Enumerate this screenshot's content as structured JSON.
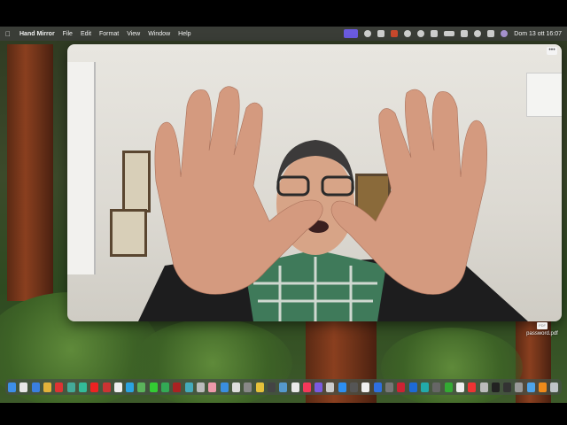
{
  "menubar": {
    "app_name": "Hand Mirror",
    "menus": [
      "File",
      "Edit",
      "Format",
      "View",
      "Window",
      "Help"
    ],
    "status_icons": [
      "screen-share-icon",
      "record-icon",
      "upload-icon",
      "fire-icon",
      "eye-icon",
      "play-icon",
      "screen-icon",
      "battery-icon",
      "wifi-icon",
      "search-icon",
      "control-center-icon",
      "siri-icon"
    ],
    "clock": "Dom 13 ott  16:07"
  },
  "window": {
    "menu_glyph": "•••"
  },
  "desktop": {
    "file_label": "password.pdf",
    "file_badge": "PDF"
  },
  "dock": {
    "icons": [
      {
        "name": "finder-icon",
        "color": "#3d8ee8"
      },
      {
        "name": "launchpad-icon",
        "color": "#e8e8e8"
      },
      {
        "name": "safari-icon",
        "color": "#3a7fe0"
      },
      {
        "name": "chrome-icon",
        "color": "#e2b23a"
      },
      {
        "name": "app-icon-1",
        "color": "#d33"
      },
      {
        "name": "app-icon-2",
        "color": "#4a9"
      },
      {
        "name": "app-icon-3",
        "color": "#3b9"
      },
      {
        "name": "youtube-icon",
        "color": "#e22"
      },
      {
        "name": "app-icon-4",
        "color": "#c33"
      },
      {
        "name": "gmail-icon",
        "color": "#eee"
      },
      {
        "name": "telegram-icon",
        "color": "#2aa3e0"
      },
      {
        "name": "maps-icon",
        "color": "#5bb35b"
      },
      {
        "name": "messages-icon",
        "color": "#3c3"
      },
      {
        "name": "app-icon-5",
        "color": "#3a5"
      },
      {
        "name": "app-icon-6",
        "color": "#a22"
      },
      {
        "name": "app-icon-7",
        "color": "#4ab"
      },
      {
        "name": "app-icon-8",
        "color": "#bbb"
      },
      {
        "name": "photos-icon",
        "color": "#e9a"
      },
      {
        "name": "app-icon-9",
        "color": "#3a8ee0"
      },
      {
        "name": "app-icon-10",
        "color": "#ddd"
      },
      {
        "name": "app-icon-11",
        "color": "#888"
      },
      {
        "name": "app-icon-12",
        "color": "#e5c13a"
      },
      {
        "name": "app-icon-13",
        "color": "#444"
      },
      {
        "name": "app-icon-14",
        "color": "#59c"
      },
      {
        "name": "app-icon-15",
        "color": "#e9e9e9"
      },
      {
        "name": "music-icon",
        "color": "#f3385a"
      },
      {
        "name": "app-icon-16",
        "color": "#7a5ae0"
      },
      {
        "name": "app-icon-17",
        "color": "#ccc"
      },
      {
        "name": "app-store-icon",
        "color": "#2d8ff0"
      },
      {
        "name": "app-icon-18",
        "color": "#555"
      },
      {
        "name": "app-icon-19",
        "color": "#f0f0f0"
      },
      {
        "name": "dropbox-icon",
        "color": "#2f6fe0"
      },
      {
        "name": "app-icon-20",
        "color": "#777"
      },
      {
        "name": "app-icon-21",
        "color": "#c23"
      },
      {
        "name": "app-icon-22",
        "color": "#1d6ad6"
      },
      {
        "name": "app-icon-23",
        "color": "#2aa"
      },
      {
        "name": "app-icon-24",
        "color": "#666"
      },
      {
        "name": "app-icon-25",
        "color": "#3a3"
      },
      {
        "name": "app-icon-26",
        "color": "#eee"
      },
      {
        "name": "app-icon-27",
        "color": "#e33"
      },
      {
        "name": "app-icon-28",
        "color": "#bbb"
      },
      {
        "name": "app-icon-29",
        "color": "#222"
      },
      {
        "name": "app-icon-30",
        "color": "#333"
      },
      {
        "name": "app-icon-31",
        "color": "#999"
      },
      {
        "name": "folder-icon",
        "color": "#4ea3e8"
      },
      {
        "name": "vlc-icon",
        "color": "#f08a1a"
      },
      {
        "name": "trash-icon",
        "color": "#bfc4c8"
      }
    ]
  }
}
